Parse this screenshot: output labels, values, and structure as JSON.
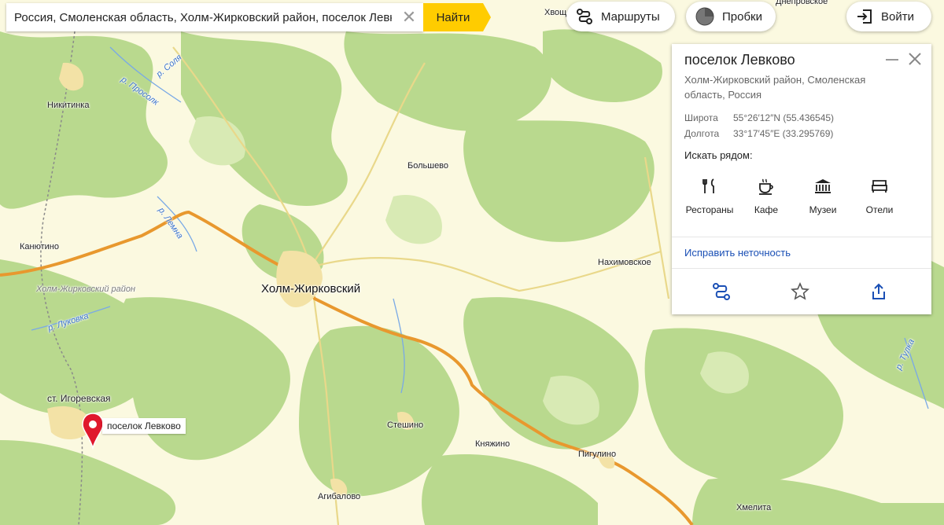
{
  "search": {
    "query": "Россия, Смоленская область, Холм-Жирковский район, поселок Левково",
    "button_label": "Найти"
  },
  "top": {
    "routes_label": "Маршруты",
    "traffic_label": "Пробки",
    "login_label": "Войти",
    "edge_label_top": "Хвощ",
    "edge_label_top_right": "Днепровское"
  },
  "panel": {
    "title": "поселок Левково",
    "subtitle": "Холм-Жирковский район, Смоленская область, Россия",
    "lat_key": "Широта",
    "lat_value": "55°26′12″N (55.436545)",
    "lon_key": "Долгота",
    "lon_value": "33°17′45″E (33.295769)",
    "nearby_label": "Искать рядом:",
    "categories": [
      {
        "label": "Рестораны",
        "icon": "fork-knife-icon"
      },
      {
        "label": "Кафе",
        "icon": "coffee-cup-icon"
      },
      {
        "label": "Музеи",
        "icon": "museum-icon"
      },
      {
        "label": "Отели",
        "icon": "bed-icon"
      }
    ],
    "fix_link": "Исправить неточность",
    "accent_color": "#1a4fb5"
  },
  "map": {
    "places": {
      "nikitinka": "Никитинка",
      "bolyshevo": "Большево",
      "kanyutino": "Канютино",
      "kholm": "Холм-Жирковский",
      "nakhimovskoe": "Нахимовское",
      "district": "Холм-Жирковский район",
      "igorevskaya": "ст. Игоревская",
      "steshino": "Стешино",
      "knyazhino": "Княжино",
      "pigulino": "Пигулино",
      "agibalovo": "Агибалово",
      "khmelita": "Хмелита"
    },
    "rivers": {
      "solya": "р. Соля",
      "prosolk": "р. Просолк",
      "lemna": "р. Лемна",
      "lukovka": "р. Луковка",
      "tulka": "р. Тулка"
    },
    "marker_label": "поселок Левково",
    "road_color": "#e8982e",
    "forest_color": "#b9d98e"
  }
}
